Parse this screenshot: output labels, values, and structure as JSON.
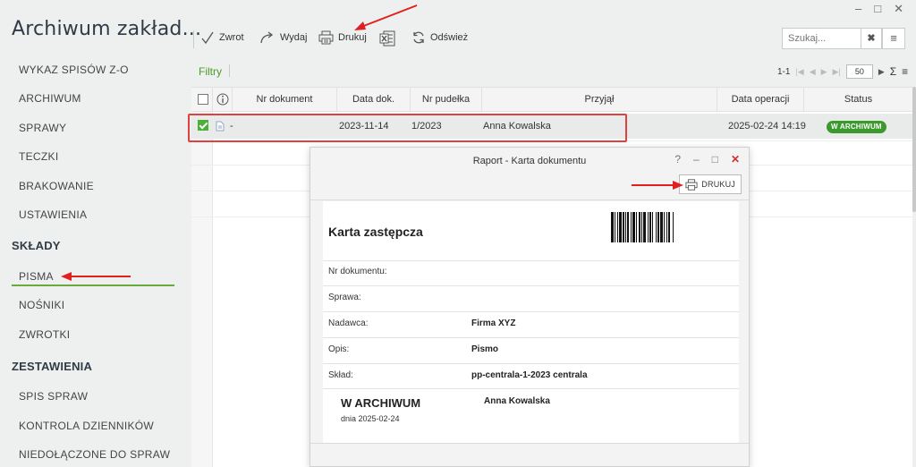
{
  "app": {
    "title": "Archiwum zakład...",
    "window_controls": {
      "minimize": "–",
      "maximize": "□",
      "close": "✕"
    }
  },
  "sidebar": {
    "items": [
      {
        "label": "WYKAZ SPISÓW Z-O",
        "type": "item"
      },
      {
        "label": "ARCHIWUM",
        "type": "item"
      },
      {
        "label": "SPRAWY",
        "type": "item"
      },
      {
        "label": "TECZKI",
        "type": "item"
      },
      {
        "label": "BRAKOWANIE",
        "type": "item"
      },
      {
        "label": "USTAWIENIA",
        "type": "item"
      },
      {
        "label": "SKŁADY",
        "type": "section"
      },
      {
        "label": "PISMA",
        "type": "item",
        "active": true
      },
      {
        "label": "NOŚNIKI",
        "type": "item"
      },
      {
        "label": "ZWROTKI",
        "type": "item"
      },
      {
        "label": "ZESTAWIENIA",
        "type": "section"
      },
      {
        "label": "SPIS SPRAW",
        "type": "item"
      },
      {
        "label": "KONTROLA DZIENNIKÓW",
        "type": "item"
      },
      {
        "label": "NIEDOŁĄCZONE DO SPRAW",
        "type": "item"
      }
    ],
    "active_color": "#6aaa3d"
  },
  "toolbar": {
    "return_label": "Zwrot",
    "issue_label": "Wydaj",
    "print_label": "Drukuj",
    "excel_icon": "excel-icon",
    "refresh_label": "Odśwież"
  },
  "search": {
    "placeholder": "Szukaj...",
    "clear": "✖",
    "menu": "≡"
  },
  "filters_label": "Filtry",
  "pager": {
    "range": "1-1",
    "page_size": "50",
    "sum_icon": "Σ"
  },
  "table": {
    "columns": [
      "Nr dokument",
      "Data dok.",
      "Nr pudełka",
      "Przyjął",
      "Data operacji",
      "Status"
    ],
    "rows": [
      {
        "checked": true,
        "nr_dokument": "-",
        "data_dok": "2023-11-14",
        "nr_pudelka": "1/2023",
        "przyjal": "Anna Kowalska",
        "data_operacji": "2025-02-24 14:19",
        "status": "W ARCHIWUM"
      }
    ]
  },
  "dialog": {
    "title": "Raport - Karta dokumentu",
    "help": "?",
    "minimize": "–",
    "maximize": "□",
    "close": "✕",
    "print_label": "DRUKUJ",
    "report": {
      "title": "Karta zastępcza",
      "fields": [
        {
          "label": "Nr dokumentu:",
          "value": ""
        },
        {
          "label": "Sprawa:",
          "value": ""
        },
        {
          "label": "Nadawca:",
          "value": "Firma XYZ"
        },
        {
          "label": "Opis:",
          "value": "Pismo"
        },
        {
          "label": "Skład:",
          "value": "pp-centrala-1-2023 centrala"
        }
      ],
      "status": "W ARCHIWUM",
      "status_date": "dnia 2025-02-24",
      "status_user": "Anna Kowalska"
    }
  },
  "colors": {
    "status_green": "#3a9a2c",
    "accent_green": "#4c9a2a",
    "annotation_red": "#e02020"
  }
}
